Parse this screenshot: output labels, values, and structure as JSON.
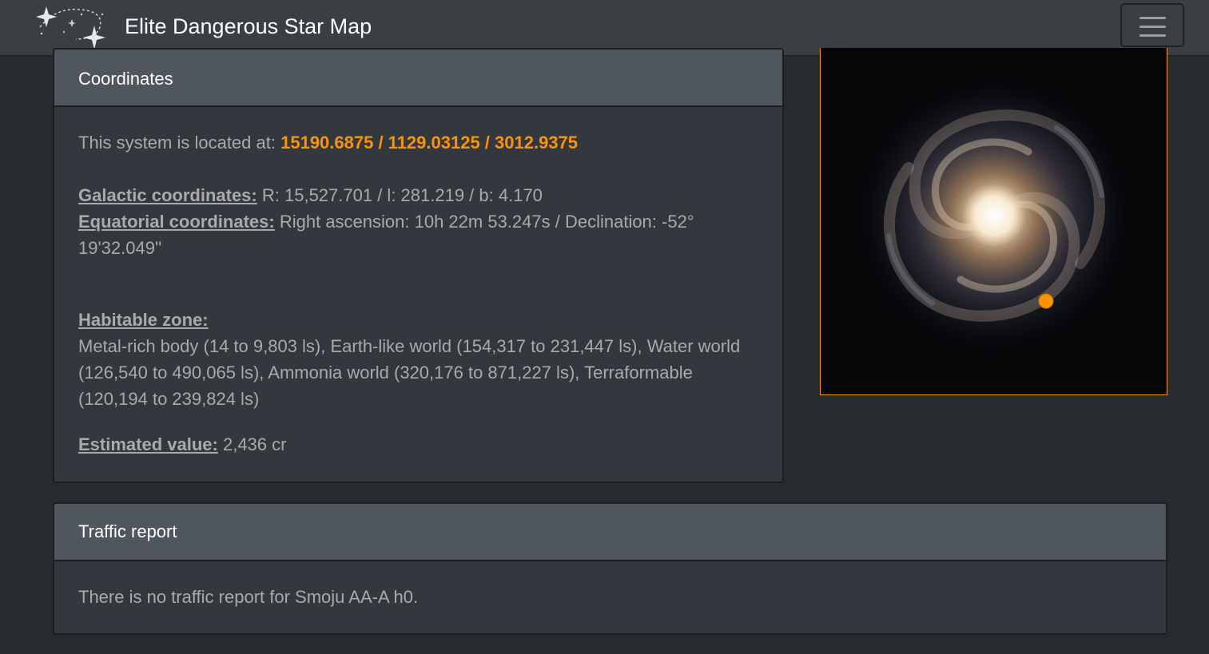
{
  "navbar": {
    "title": "Elite Dangerous Star Map",
    "logo_icon": "stars-logo-icon",
    "menu_icon": "hamburger-menu-icon"
  },
  "coordinates": {
    "header": "Coordinates",
    "located_prefix": "This system is located at:",
    "located_value": "15190.6875 / 1129.03125 / 3012.9375",
    "galactic_label": "Galactic coordinates:",
    "galactic_value": "R: 15,527.701 / l: 281.219 / b: 4.170",
    "equatorial_label": "Equatorial coordinates:",
    "equatorial_value": "Right ascension: 10h 22m 53.247s / Declination: -52° 19'32.049''",
    "habitable_label": "Habitable zone:",
    "habitable_value": "Metal-rich body (14 to 9,803 ls), Earth-like world (154,317 to 231,447 ls), Water world (126,540 to 490,065 ls), Ammonia world (320,176 to 871,227 ls), Terraformable (120,194 to 239,824 ls)",
    "value_label": "Estimated value:",
    "value_value": "2,436 cr"
  },
  "galaxy_map": {
    "image": "milky-way-galaxy-map",
    "marker_color": "#f89406"
  },
  "traffic": {
    "header": "Traffic report",
    "message": "There is no traffic report for Smoju AA-A h0."
  },
  "colors": {
    "accent": "#f89406",
    "background": "#272b30",
    "card": "#32383e",
    "card_header": "#4f565d"
  }
}
